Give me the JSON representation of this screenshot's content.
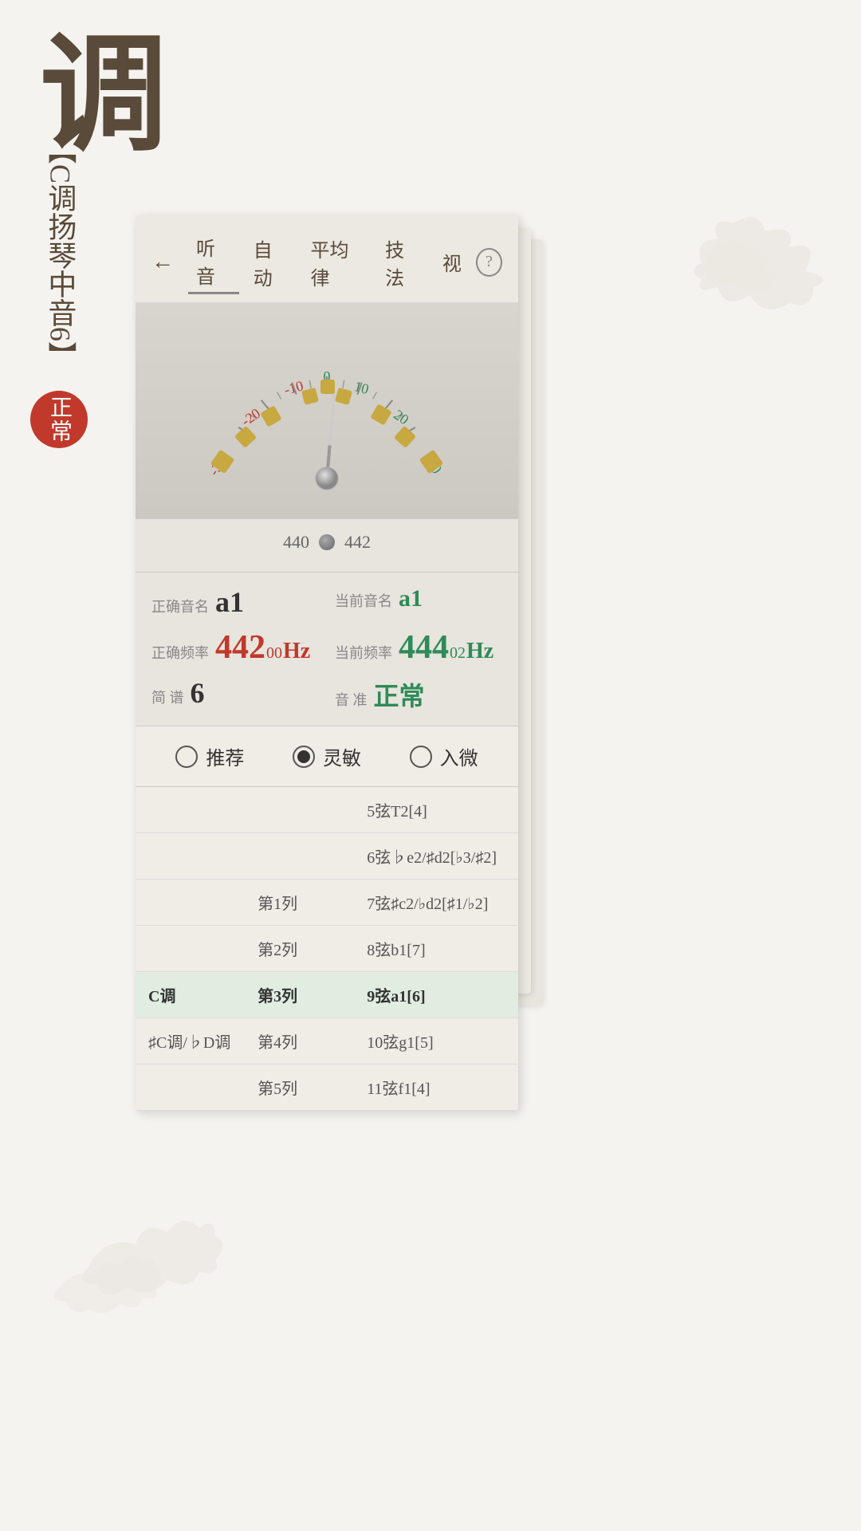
{
  "app": {
    "title": "调",
    "vertical_label": "【C调扬琴中音6】",
    "status_badge": "正常"
  },
  "nav": {
    "back_icon": "←",
    "items": [
      {
        "label": "听音",
        "active": true
      },
      {
        "label": "自动",
        "active": false
      },
      {
        "label": "平均律",
        "active": false
      },
      {
        "label": "技法",
        "active": false
      },
      {
        "label": "视",
        "active": false
      }
    ],
    "help_icon": "?"
  },
  "tuner": {
    "freq_low": "440",
    "freq_high": "442",
    "correct_note_label": "正确音名",
    "correct_note_value": "a1",
    "current_note_label": "当前音名",
    "current_note_value": "a1",
    "correct_freq_label": "正确频率",
    "correct_freq_value": "442",
    "correct_freq_decimal": "00",
    "correct_freq_unit": "Hz",
    "current_freq_label": "当前频率",
    "current_freq_value": "444",
    "current_freq_decimal": "02",
    "current_freq_unit": "Hz",
    "jianpu_label": "简    谱",
    "jianpu_value": "6",
    "pitch_label": "音    准",
    "pitch_value": "正常"
  },
  "sensitivity": {
    "options": [
      {
        "label": "推荐",
        "selected": false
      },
      {
        "label": "灵敏",
        "selected": true
      },
      {
        "label": "入微",
        "selected": false
      }
    ]
  },
  "table": {
    "rows": [
      {
        "col1": "",
        "col2": "",
        "col3": "5弦T2[4]"
      },
      {
        "col1": "",
        "col2": "",
        "col3": "6弦♭e2/♯d2[♭3/♯2]"
      },
      {
        "col1": "",
        "col2": "第1列",
        "col3": "7弦♯c2/♭d2[♯1/♭2]"
      },
      {
        "col1": "",
        "col2": "第2列",
        "col3": "8弦b1[7]"
      },
      {
        "col1": "C调",
        "col2": "第3列",
        "col3": "9弦a1[6]",
        "highlight": true
      },
      {
        "col1": "♯C调/♭D调",
        "col2": "第4列",
        "col3": "10弦g1[5]"
      },
      {
        "col1": "",
        "col2": "第5列",
        "col3": "11弦f1[4]"
      }
    ]
  }
}
